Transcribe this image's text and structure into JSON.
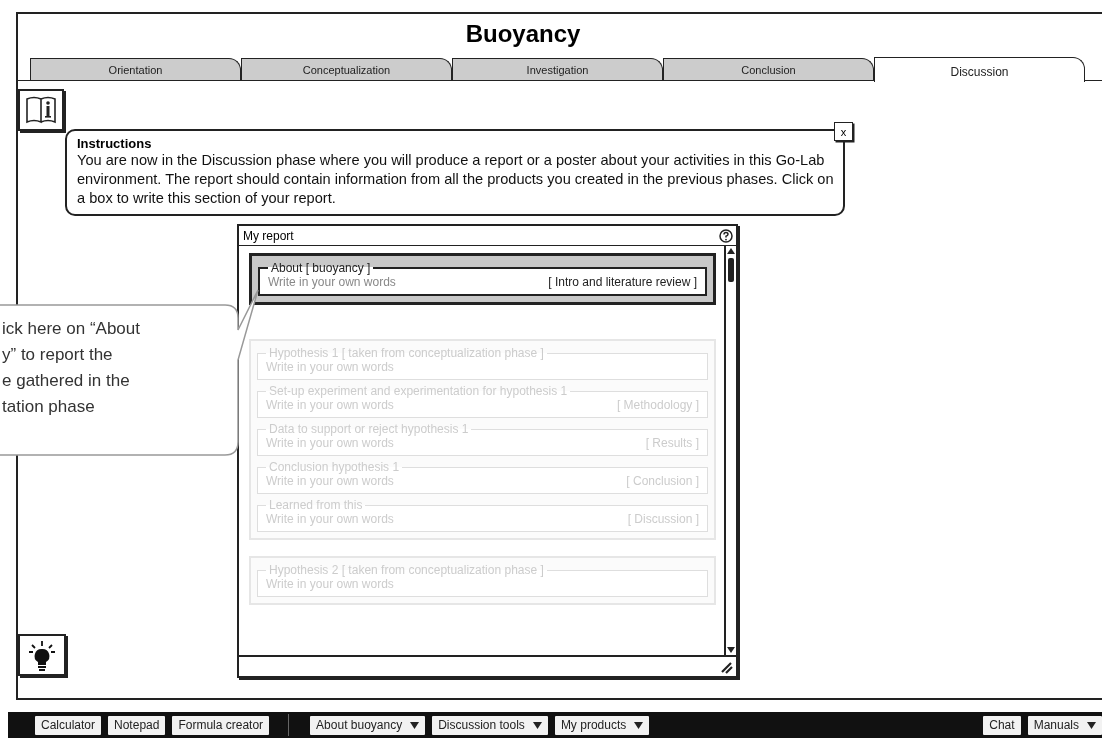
{
  "title": "Buoyancy",
  "tabs": [
    {
      "label": "Orientation",
      "selected": false
    },
    {
      "label": "Conceptualization",
      "selected": false
    },
    {
      "label": "Investigation",
      "selected": false
    },
    {
      "label": "Conclusion",
      "selected": false
    },
    {
      "label": "Discussion",
      "selected": true
    }
  ],
  "instructions": {
    "title": "Instructions",
    "text": "You are now in the Discussion phase where you will produce a report or a poster about your activities in this Go-Lab environment. The report should contain information from all the products you created in the previous phases. Click on a box to write this section of your report.",
    "close": "x"
  },
  "hint_callout": {
    "lines": [
      "ick here on “About",
      "y” to report the",
      "e gathered in the",
      "tation phase"
    ]
  },
  "report": {
    "title": "My report",
    "groups": [
      {
        "sections": [
          {
            "title": "About [ buoyancy ]",
            "placeholder": "Write in your own words",
            "tag": "[ Intro and literature review ]",
            "disabled": false
          }
        ]
      },
      {
        "sections": [
          {
            "title": "Hypothesis 1 [ taken from conceptualization phase ]",
            "placeholder": "Write in your own words",
            "disabled": true
          },
          {
            "title": "Set-up experiment and experimentation for hypothesis 1",
            "placeholder": "Write in your own words",
            "tag": "[ Methodology ]",
            "disabled": true
          },
          {
            "title": "Data to support or reject hypothesis 1",
            "placeholder": "Write in your own words",
            "tag": "[ Results ]",
            "disabled": true
          },
          {
            "title": "Conclusion hypothesis 1",
            "placeholder": "Write in your own words",
            "tag": "[ Conclusion ]",
            "disabled": true
          },
          {
            "title": "Learned from this",
            "placeholder": "Write in your own words",
            "tag": "[ Discussion ]",
            "disabled": true
          }
        ]
      },
      {
        "sections": [
          {
            "title": "Hypothesis 2 [ taken from conceptualization phase ]",
            "placeholder": "Write in your own words",
            "disabled": true
          }
        ]
      }
    ]
  },
  "toolbar": {
    "tools": [
      {
        "label": "Calculator",
        "kind": "button"
      },
      {
        "label": "Notepad",
        "kind": "button"
      },
      {
        "label": "Formula creator",
        "kind": "button"
      }
    ],
    "menus": [
      {
        "label": "About buoyancy",
        "kind": "menu"
      },
      {
        "label": "Discussion tools",
        "kind": "menu"
      },
      {
        "label": "My products",
        "kind": "menu"
      }
    ],
    "right": [
      {
        "label": "Chat",
        "kind": "button"
      },
      {
        "label": "Manuals",
        "kind": "menu"
      }
    ]
  }
}
